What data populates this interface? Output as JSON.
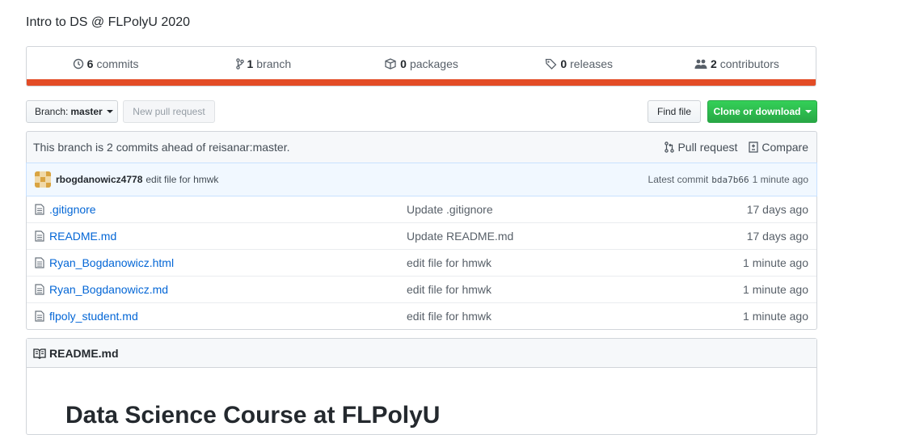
{
  "repo": {
    "description": "Intro to DS @ FLPolyU 2020"
  },
  "summary": {
    "commits_count": "6",
    "commits_label": "commits",
    "branch_count": "1",
    "branch_label": "branch",
    "packages_count": "0",
    "packages_label": "packages",
    "releases_count": "0",
    "releases_label": "releases",
    "contributors_count": "2",
    "contributors_label": "contributors",
    "language_bar_color": "#e34c26"
  },
  "toolbar": {
    "branch_prefix": "Branch:",
    "branch_name": "master",
    "new_pr": "New pull request",
    "find_file": "Find file",
    "clone": "Clone or download"
  },
  "branch_info": {
    "text": "This branch is 2 commits ahead of reisanar:master.",
    "pull_request": "Pull request",
    "compare": "Compare"
  },
  "latest_commit": {
    "author": "rbogdanowicz4778",
    "message": "edit file for hmwk",
    "label": "Latest commit",
    "sha": "bda7b66",
    "age": "1 minute ago"
  },
  "files": [
    {
      "name": ".gitignore",
      "message": "Update .gitignore",
      "age": "17 days ago"
    },
    {
      "name": "README.md",
      "message": "Update README.md",
      "age": "17 days ago"
    },
    {
      "name": "Ryan_Bogdanowicz.html",
      "message": "edit file for hmwk",
      "age": "1 minute ago"
    },
    {
      "name": "Ryan_Bogdanowicz.md",
      "message": "edit file for hmwk",
      "age": "1 minute ago"
    },
    {
      "name": "flpoly_student.md",
      "message": "edit file for hmwk",
      "age": "1 minute ago"
    }
  ],
  "readme": {
    "filename": "README.md",
    "title": "Data Science Course at FLPolyU"
  }
}
